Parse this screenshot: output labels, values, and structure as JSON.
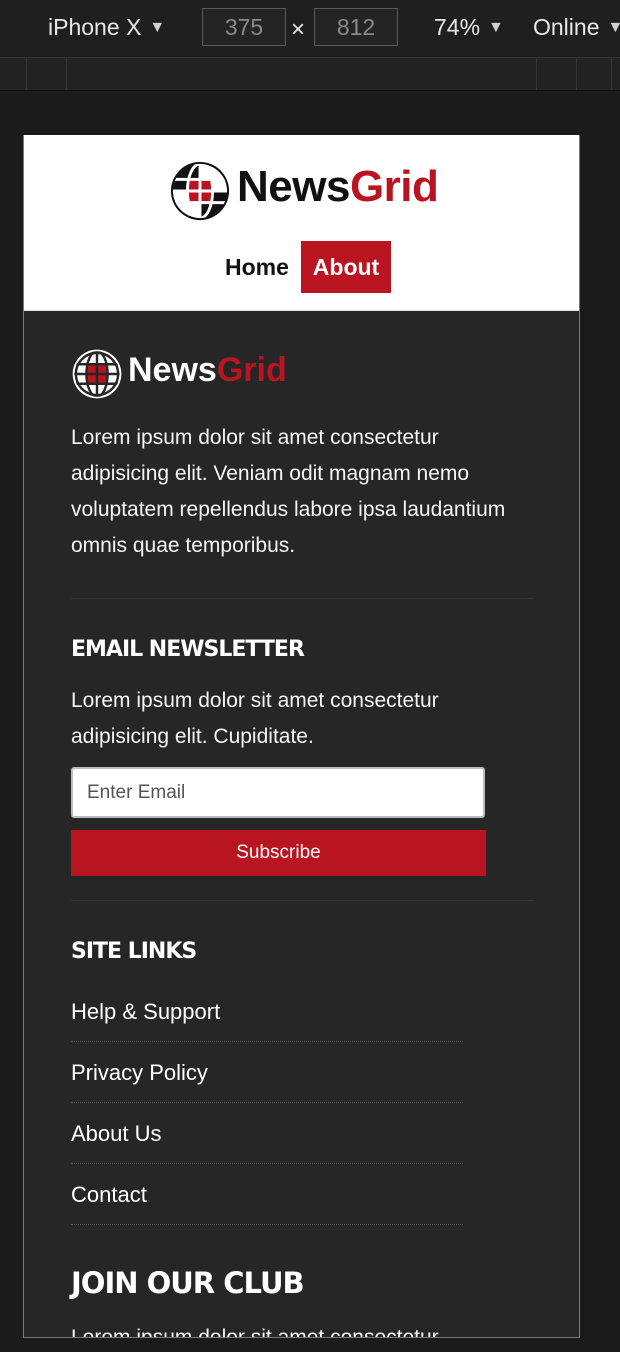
{
  "devtools": {
    "device": "iPhone X",
    "width": "375",
    "height": "812",
    "separator": "×",
    "zoom": "74%",
    "network": "Online"
  },
  "site": {
    "brand_part1": "News",
    "brand_part2": "Grid",
    "brand_accent": "#b91520",
    "nav": [
      "Home",
      "About"
    ],
    "active_nav": "About"
  },
  "footer": {
    "about_text": "Lorem ipsum dolor sit amet consectetur adipisicing elit. Veniam odit magnam nemo voluptatem repellendus labore ipsa laudantium omnis quae temporibus.",
    "newsletter": {
      "heading": "Email Newsletter",
      "text": "Lorem ipsum dolor sit amet consectetur adipisicing elit. Cupiditate.",
      "email_placeholder": "Enter Email",
      "email_value": "",
      "subscribe_label": "Subscribe"
    },
    "site_links": {
      "heading": "Site Links",
      "items": [
        "Help & Support",
        "Privacy Policy",
        "About Us",
        "Contact"
      ]
    },
    "club": {
      "heading": "Join Our Club",
      "text": "Lorem ipsum dolor sit amet consectetur"
    }
  }
}
